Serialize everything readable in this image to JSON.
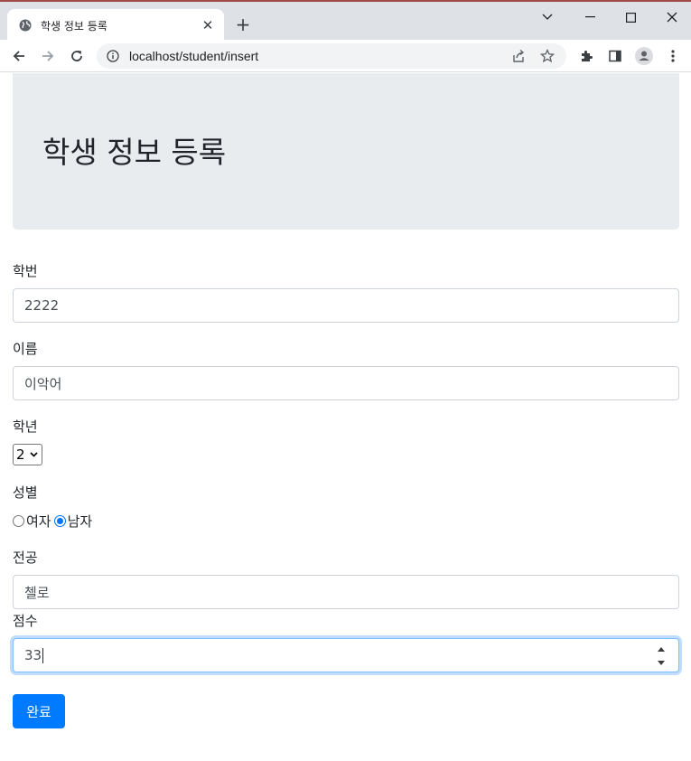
{
  "browser": {
    "tab_title": "학생 정보 등록",
    "url": "localhost/student/insert"
  },
  "page": {
    "heading": "학생 정보 등록"
  },
  "form": {
    "student_id": {
      "label": "학번",
      "value": "2222"
    },
    "name": {
      "label": "이름",
      "value": "이악어"
    },
    "grade": {
      "label": "학년",
      "selected": "2"
    },
    "gender": {
      "label": "성별",
      "options": [
        {
          "label": "여자",
          "checked": false
        },
        {
          "label": "남자",
          "checked": true
        }
      ]
    },
    "major": {
      "label": "전공",
      "value": "첼로"
    },
    "score": {
      "label": "점수",
      "value": "33"
    },
    "submit_label": "완료"
  },
  "colors": {
    "primary": "#007bff",
    "jumbotron_bg": "#e9ecef",
    "focus_border": "#80bdff"
  }
}
